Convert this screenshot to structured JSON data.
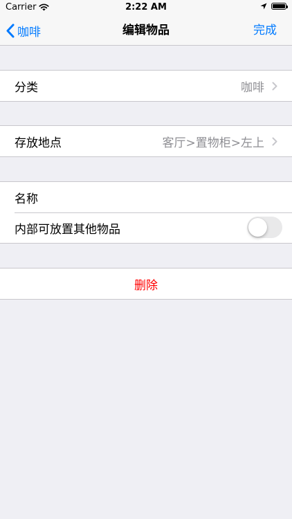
{
  "status_bar": {
    "carrier": "Carrier",
    "time": "2:22 AM"
  },
  "nav": {
    "back_label": "咖啡",
    "title": "编辑物品",
    "done_label": "完成"
  },
  "form": {
    "category": {
      "label": "分类",
      "value": "咖啡"
    },
    "location": {
      "label": "存放地点",
      "value": "客厅>置物柜>左上"
    },
    "name": {
      "label": "名称"
    },
    "container": {
      "label": "内部可放置其他物品",
      "enabled": false
    },
    "delete_label": "删除"
  },
  "colors": {
    "accent": "#007aff",
    "destructive": "#ff0000",
    "background": "#efeff4"
  }
}
